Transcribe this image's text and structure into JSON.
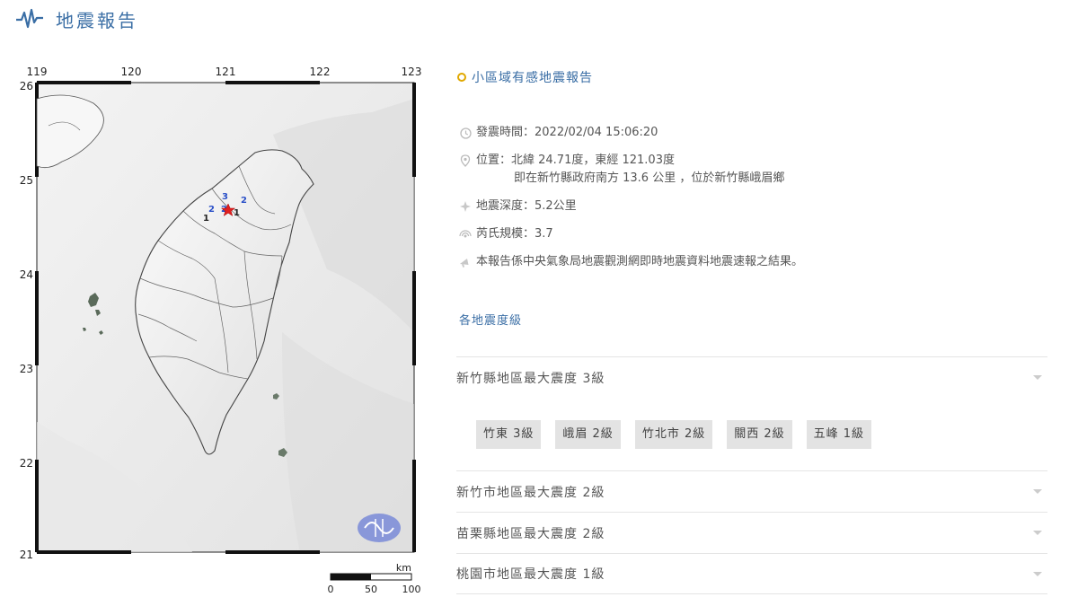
{
  "header": {
    "title": "地震報告",
    "logo_icon": "seismograph-icon"
  },
  "map": {
    "lon_labels": [
      "119",
      "120",
      "121",
      "122",
      "123"
    ],
    "lat_labels": [
      "26",
      "25",
      "24",
      "23",
      "22",
      "21"
    ],
    "intensity_marks": [
      "3",
      "2",
      "2",
      "1",
      "2",
      "1"
    ],
    "scale": {
      "unit": "km",
      "ticks": [
        "0",
        "50",
        "100"
      ]
    }
  },
  "report": {
    "title": "小區域有感地震報告",
    "time": "發震時間：2022/02/04 15:06:20",
    "location_line1": "位置：北緯 24.71度，東經 121.03度",
    "location_line2": "即在新竹縣政府南方 13.6 公里 ，位於新竹縣峨眉鄉",
    "depth": "地震深度：5.2公里",
    "magnitude": "芮氏規模：3.7",
    "note": "本報告係中央氣象局地震觀測網即時地震資料地震速報之結果。"
  },
  "intensity_section": {
    "title": "各地震度級"
  },
  "counties": [
    {
      "label": "新竹縣地區最大震度 3級"
    },
    {
      "label": "新竹市地區最大震度 2級"
    },
    {
      "label": "苗栗縣地區最大震度 2級"
    },
    {
      "label": "桃園市地區最大震度 1級"
    }
  ],
  "towns": [
    {
      "label": "竹東 3級"
    },
    {
      "label": "峨眉 2級"
    },
    {
      "label": "竹北市 2級"
    },
    {
      "label": "關西 2級"
    },
    {
      "label": "五峰 1級"
    }
  ],
  "colors": {
    "accent": "#3a6ea5",
    "dot": "#e0a800",
    "epicenter": "#e02020"
  }
}
